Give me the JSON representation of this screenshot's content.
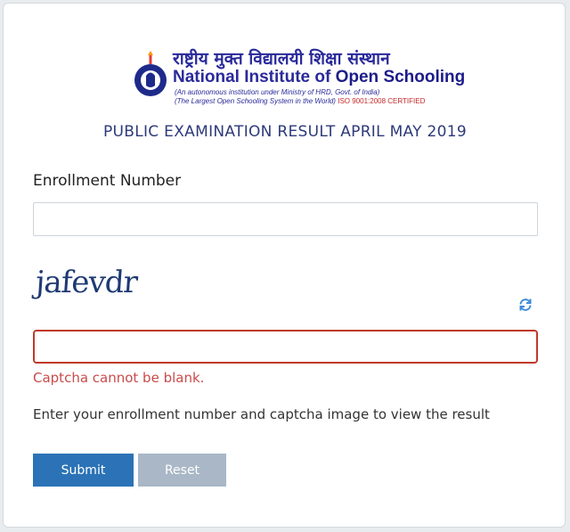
{
  "header": {
    "hindi_name": "राष्ट्रीय मुक्त विद्यालयी शिक्षा संस्थान",
    "english_name_prefix": "National Institute of ",
    "english_name_bold": "Open Schooling",
    "subtitle_1": "(An autonomous institution under Ministry of HRD, Govt. of India)",
    "subtitle_2": "(The Largest Open Schooling System in the World)",
    "iso": "ISO 9001:2008 CERTIFIED"
  },
  "page_title": "PUBLIC EXAMINATION RESULT APRIL MAY 2019",
  "form": {
    "enrollment_label": "Enrollment Number",
    "enrollment_value": "",
    "captcha_text": "jafevdr",
    "captcha_value": "",
    "error": "Captcha cannot be blank.",
    "help": "Enter your enrollment number and captcha image to view the result",
    "submit_label": "Submit",
    "reset_label": "Reset"
  },
  "icons": {
    "refresh": "refresh-icon",
    "logo": "nios-logo-icon"
  },
  "colors": {
    "brand_blue": "#2a2a9b",
    "submit": "#2b73b6",
    "reset": "#a9b7c6",
    "error": "#c0392b"
  }
}
